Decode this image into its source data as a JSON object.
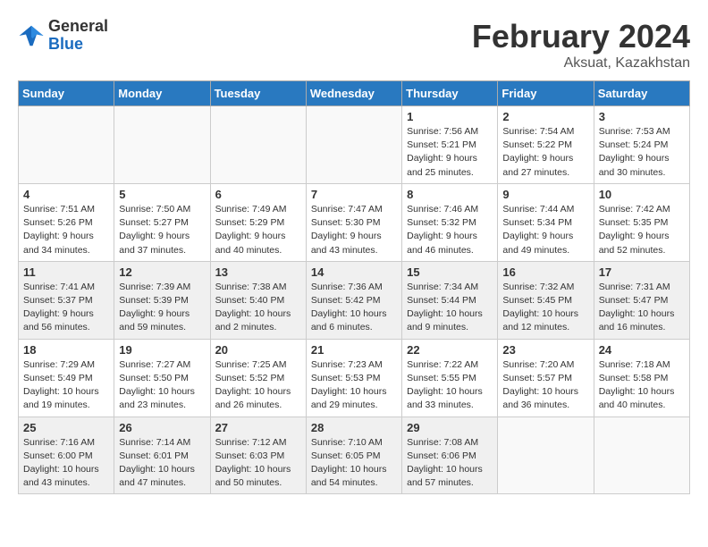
{
  "header": {
    "logo_line1": "General",
    "logo_line2": "Blue",
    "month_title": "February 2024",
    "location": "Aksuat, Kazakhstan"
  },
  "weekdays": [
    "Sunday",
    "Monday",
    "Tuesday",
    "Wednesday",
    "Thursday",
    "Friday",
    "Saturday"
  ],
  "weeks": [
    {
      "shaded": false,
      "days": [
        {
          "num": "",
          "info": ""
        },
        {
          "num": "",
          "info": ""
        },
        {
          "num": "",
          "info": ""
        },
        {
          "num": "",
          "info": ""
        },
        {
          "num": "1",
          "info": "Sunrise: 7:56 AM\nSunset: 5:21 PM\nDaylight: 9 hours\nand 25 minutes."
        },
        {
          "num": "2",
          "info": "Sunrise: 7:54 AM\nSunset: 5:22 PM\nDaylight: 9 hours\nand 27 minutes."
        },
        {
          "num": "3",
          "info": "Sunrise: 7:53 AM\nSunset: 5:24 PM\nDaylight: 9 hours\nand 30 minutes."
        }
      ]
    },
    {
      "shaded": false,
      "days": [
        {
          "num": "4",
          "info": "Sunrise: 7:51 AM\nSunset: 5:26 PM\nDaylight: 9 hours\nand 34 minutes."
        },
        {
          "num": "5",
          "info": "Sunrise: 7:50 AM\nSunset: 5:27 PM\nDaylight: 9 hours\nand 37 minutes."
        },
        {
          "num": "6",
          "info": "Sunrise: 7:49 AM\nSunset: 5:29 PM\nDaylight: 9 hours\nand 40 minutes."
        },
        {
          "num": "7",
          "info": "Sunrise: 7:47 AM\nSunset: 5:30 PM\nDaylight: 9 hours\nand 43 minutes."
        },
        {
          "num": "8",
          "info": "Sunrise: 7:46 AM\nSunset: 5:32 PM\nDaylight: 9 hours\nand 46 minutes."
        },
        {
          "num": "9",
          "info": "Sunrise: 7:44 AM\nSunset: 5:34 PM\nDaylight: 9 hours\nand 49 minutes."
        },
        {
          "num": "10",
          "info": "Sunrise: 7:42 AM\nSunset: 5:35 PM\nDaylight: 9 hours\nand 52 minutes."
        }
      ]
    },
    {
      "shaded": true,
      "days": [
        {
          "num": "11",
          "info": "Sunrise: 7:41 AM\nSunset: 5:37 PM\nDaylight: 9 hours\nand 56 minutes."
        },
        {
          "num": "12",
          "info": "Sunrise: 7:39 AM\nSunset: 5:39 PM\nDaylight: 9 hours\nand 59 minutes."
        },
        {
          "num": "13",
          "info": "Sunrise: 7:38 AM\nSunset: 5:40 PM\nDaylight: 10 hours\nand 2 minutes."
        },
        {
          "num": "14",
          "info": "Sunrise: 7:36 AM\nSunset: 5:42 PM\nDaylight: 10 hours\nand 6 minutes."
        },
        {
          "num": "15",
          "info": "Sunrise: 7:34 AM\nSunset: 5:44 PM\nDaylight: 10 hours\nand 9 minutes."
        },
        {
          "num": "16",
          "info": "Sunrise: 7:32 AM\nSunset: 5:45 PM\nDaylight: 10 hours\nand 12 minutes."
        },
        {
          "num": "17",
          "info": "Sunrise: 7:31 AM\nSunset: 5:47 PM\nDaylight: 10 hours\nand 16 minutes."
        }
      ]
    },
    {
      "shaded": false,
      "days": [
        {
          "num": "18",
          "info": "Sunrise: 7:29 AM\nSunset: 5:49 PM\nDaylight: 10 hours\nand 19 minutes."
        },
        {
          "num": "19",
          "info": "Sunrise: 7:27 AM\nSunset: 5:50 PM\nDaylight: 10 hours\nand 23 minutes."
        },
        {
          "num": "20",
          "info": "Sunrise: 7:25 AM\nSunset: 5:52 PM\nDaylight: 10 hours\nand 26 minutes."
        },
        {
          "num": "21",
          "info": "Sunrise: 7:23 AM\nSunset: 5:53 PM\nDaylight: 10 hours\nand 29 minutes."
        },
        {
          "num": "22",
          "info": "Sunrise: 7:22 AM\nSunset: 5:55 PM\nDaylight: 10 hours\nand 33 minutes."
        },
        {
          "num": "23",
          "info": "Sunrise: 7:20 AM\nSunset: 5:57 PM\nDaylight: 10 hours\nand 36 minutes."
        },
        {
          "num": "24",
          "info": "Sunrise: 7:18 AM\nSunset: 5:58 PM\nDaylight: 10 hours\nand 40 minutes."
        }
      ]
    },
    {
      "shaded": true,
      "days": [
        {
          "num": "25",
          "info": "Sunrise: 7:16 AM\nSunset: 6:00 PM\nDaylight: 10 hours\nand 43 minutes."
        },
        {
          "num": "26",
          "info": "Sunrise: 7:14 AM\nSunset: 6:01 PM\nDaylight: 10 hours\nand 47 minutes."
        },
        {
          "num": "27",
          "info": "Sunrise: 7:12 AM\nSunset: 6:03 PM\nDaylight: 10 hours\nand 50 minutes."
        },
        {
          "num": "28",
          "info": "Sunrise: 7:10 AM\nSunset: 6:05 PM\nDaylight: 10 hours\nand 54 minutes."
        },
        {
          "num": "29",
          "info": "Sunrise: 7:08 AM\nSunset: 6:06 PM\nDaylight: 10 hours\nand 57 minutes."
        },
        {
          "num": "",
          "info": ""
        },
        {
          "num": "",
          "info": ""
        }
      ]
    }
  ]
}
